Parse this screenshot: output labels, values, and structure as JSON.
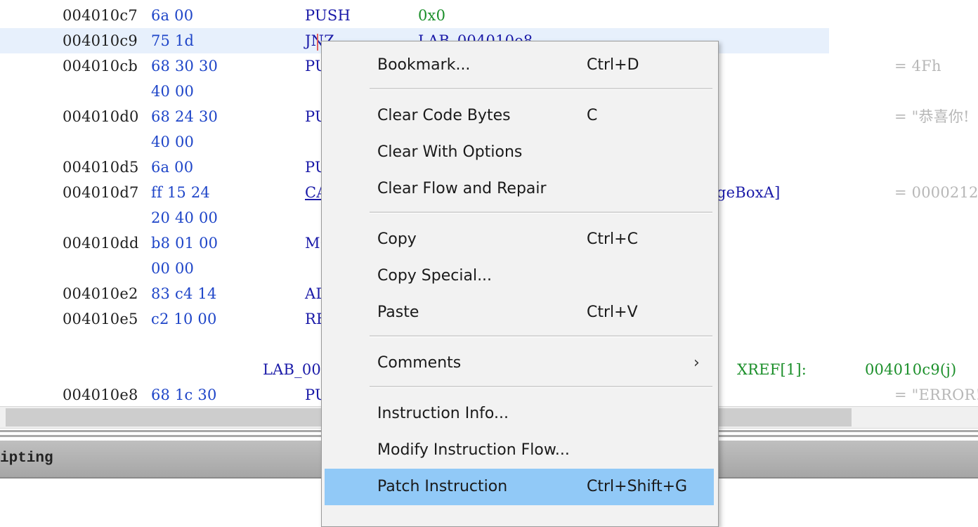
{
  "listing": {
    "rows": [
      {
        "addr": "004010c7",
        "bytes": "6a 00",
        "mnem": "PUSH",
        "operand": "0x0",
        "comment": ""
      },
      {
        "addr": "004010c9",
        "bytes": "75 1d",
        "mnem": "JNZ",
        "operand": "LAB_004010e8",
        "comment": ""
      },
      {
        "addr": "004010cb",
        "bytes": "68 30 30",
        "mnem": "PU",
        "operand": "",
        "comment": "= 4Fh"
      },
      {
        "addr": "",
        "bytes": "40 00",
        "mnem": "",
        "operand": "",
        "comment": ""
      },
      {
        "addr": "004010d0",
        "bytes": "68 24 30",
        "mnem": "PU",
        "operand": "",
        "comment": "= \"恭喜你!"
      },
      {
        "addr": "",
        "bytes": "40 00",
        "mnem": "",
        "operand": "",
        "comment": ""
      },
      {
        "addr": "004010d5",
        "bytes": "6a 00",
        "mnem": "PU",
        "operand": "",
        "comment": ""
      },
      {
        "addr": "004010d7",
        "bytes": "ff 15 24",
        "mnem": "CA",
        "operand": "geBoxA]",
        "comment": "= 0000212"
      },
      {
        "addr": "",
        "bytes": "20 40 00",
        "mnem": "",
        "operand": "",
        "comment": ""
      },
      {
        "addr": "004010dd",
        "bytes": "b8 01 00",
        "mnem": "MO",
        "operand": "",
        "comment": ""
      },
      {
        "addr": "",
        "bytes": "00 00",
        "mnem": "",
        "operand": "",
        "comment": ""
      },
      {
        "addr": "004010e2",
        "bytes": "83 c4 14",
        "mnem": "AD",
        "operand": "",
        "comment": ""
      },
      {
        "addr": "004010e5",
        "bytes": "c2 10 00",
        "mnem": "RE",
        "operand": "",
        "comment": ""
      },
      {
        "addr": "004010e8",
        "bytes": "68 1c 30",
        "mnem": "PU",
        "operand": "",
        "comment": "= \"ERROR!"
      }
    ],
    "label": "LAB_00",
    "xref_label": "XREF[1]:",
    "xref_target": "004010c9(j)"
  },
  "panel": {
    "title": "ipting"
  },
  "context_menu": {
    "items": [
      {
        "label": "Bookmark...",
        "shortcut": "Ctrl+D"
      },
      {
        "label": "Clear Code Bytes",
        "shortcut": "C"
      },
      {
        "label": "Clear With Options",
        "shortcut": ""
      },
      {
        "label": "Clear Flow and Repair",
        "shortcut": ""
      },
      {
        "label": "Copy",
        "shortcut": "Ctrl+C"
      },
      {
        "label": "Copy Special...",
        "shortcut": ""
      },
      {
        "label": "Paste",
        "shortcut": "Ctrl+V"
      },
      {
        "label": "Comments",
        "shortcut": "",
        "submenu_arrow": "›"
      },
      {
        "label": "Instruction Info...",
        "shortcut": ""
      },
      {
        "label": "Modify Instruction Flow...",
        "shortcut": ""
      },
      {
        "label": "Patch Instruction",
        "shortcut": "Ctrl+Shift+G"
      }
    ]
  },
  "colors": {
    "highlight_row": "#e7f0fc",
    "menu_active": "#91c9f7",
    "bytes_blue": "#1e45c8",
    "xref_green": "#1b8f2a"
  }
}
